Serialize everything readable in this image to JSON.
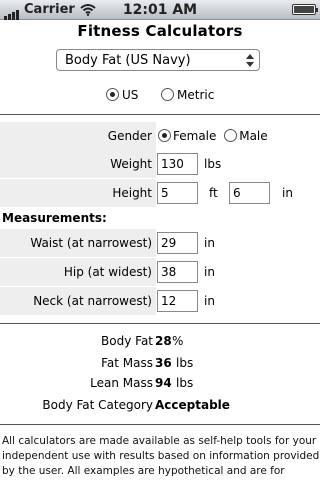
{
  "status_bar": {
    "carrier": "Carrier",
    "time": "12:01 AM"
  },
  "header": {
    "title": "Fitness Calculators"
  },
  "calculator_select": {
    "selected": "Body Fat (US Navy)"
  },
  "unit_system": {
    "us_label": "US",
    "metric_label": "Metric",
    "selected": "US"
  },
  "gender": {
    "label": "Gender",
    "female_label": "Female",
    "male_label": "Male",
    "selected": "Female"
  },
  "weight": {
    "label": "Weight",
    "value": "130",
    "unit": "lbs"
  },
  "height": {
    "label": "Height",
    "feet_value": "5",
    "feet_unit": "ft",
    "inches_value": "6",
    "inches_unit": "in"
  },
  "measurements": {
    "heading": "Measurements:",
    "waist": {
      "label": "Waist (at narrowest)",
      "value": "29",
      "unit": "in"
    },
    "hip": {
      "label": "Hip (at widest)",
      "value": "38",
      "unit": "in"
    },
    "neck": {
      "label": "Neck (at narrowest)",
      "value": "12",
      "unit": "in"
    }
  },
  "results": {
    "body_fat": {
      "label": "Body Fat",
      "value": "28",
      "unit": "%"
    },
    "fat_mass": {
      "label": "Fat Mass",
      "value": "36",
      "unit": "lbs"
    },
    "lean_mass": {
      "label": "Lean Mass",
      "value": "94",
      "unit": "lbs"
    },
    "category": {
      "label": "Body Fat Category",
      "value": "Acceptable"
    }
  },
  "disclaimer": "All calculators are made available as self-help tools for your independent use with results based on information provided by the user. All examples are hypothetical and are for illustrative",
  "icons": [
    "signal-icon",
    "wifi-icon",
    "battery-icon",
    "select-arrows-icon"
  ]
}
